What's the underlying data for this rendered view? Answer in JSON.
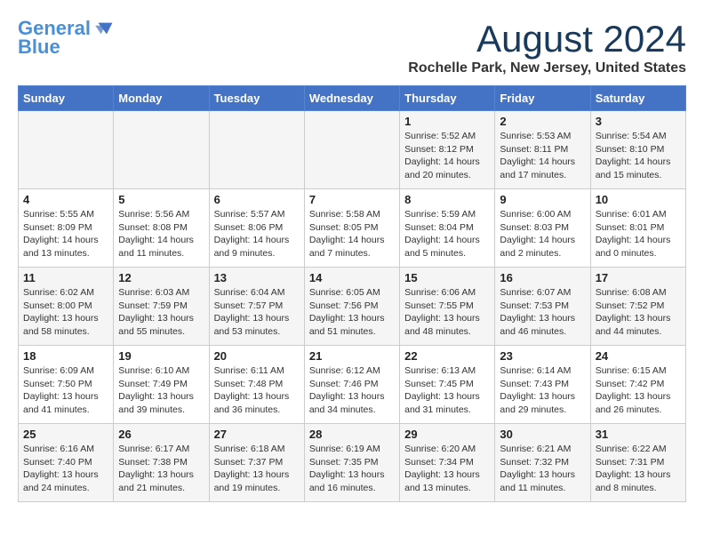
{
  "header": {
    "logo_line1": "General",
    "logo_line2": "Blue",
    "month_year": "August 2024",
    "location": "Rochelle Park, New Jersey, United States"
  },
  "weekdays": [
    "Sunday",
    "Monday",
    "Tuesday",
    "Wednesday",
    "Thursday",
    "Friday",
    "Saturday"
  ],
  "weeks": [
    [
      {
        "day": "",
        "content": ""
      },
      {
        "day": "",
        "content": ""
      },
      {
        "day": "",
        "content": ""
      },
      {
        "day": "",
        "content": ""
      },
      {
        "day": "1",
        "content": "Sunrise: 5:52 AM\nSunset: 8:12 PM\nDaylight: 14 hours\nand 20 minutes."
      },
      {
        "day": "2",
        "content": "Sunrise: 5:53 AM\nSunset: 8:11 PM\nDaylight: 14 hours\nand 17 minutes."
      },
      {
        "day": "3",
        "content": "Sunrise: 5:54 AM\nSunset: 8:10 PM\nDaylight: 14 hours\nand 15 minutes."
      }
    ],
    [
      {
        "day": "4",
        "content": "Sunrise: 5:55 AM\nSunset: 8:09 PM\nDaylight: 14 hours\nand 13 minutes."
      },
      {
        "day": "5",
        "content": "Sunrise: 5:56 AM\nSunset: 8:08 PM\nDaylight: 14 hours\nand 11 minutes."
      },
      {
        "day": "6",
        "content": "Sunrise: 5:57 AM\nSunset: 8:06 PM\nDaylight: 14 hours\nand 9 minutes."
      },
      {
        "day": "7",
        "content": "Sunrise: 5:58 AM\nSunset: 8:05 PM\nDaylight: 14 hours\nand 7 minutes."
      },
      {
        "day": "8",
        "content": "Sunrise: 5:59 AM\nSunset: 8:04 PM\nDaylight: 14 hours\nand 5 minutes."
      },
      {
        "day": "9",
        "content": "Sunrise: 6:00 AM\nSunset: 8:03 PM\nDaylight: 14 hours\nand 2 minutes."
      },
      {
        "day": "10",
        "content": "Sunrise: 6:01 AM\nSunset: 8:01 PM\nDaylight: 14 hours\nand 0 minutes."
      }
    ],
    [
      {
        "day": "11",
        "content": "Sunrise: 6:02 AM\nSunset: 8:00 PM\nDaylight: 13 hours\nand 58 minutes."
      },
      {
        "day": "12",
        "content": "Sunrise: 6:03 AM\nSunset: 7:59 PM\nDaylight: 13 hours\nand 55 minutes."
      },
      {
        "day": "13",
        "content": "Sunrise: 6:04 AM\nSunset: 7:57 PM\nDaylight: 13 hours\nand 53 minutes."
      },
      {
        "day": "14",
        "content": "Sunrise: 6:05 AM\nSunset: 7:56 PM\nDaylight: 13 hours\nand 51 minutes."
      },
      {
        "day": "15",
        "content": "Sunrise: 6:06 AM\nSunset: 7:55 PM\nDaylight: 13 hours\nand 48 minutes."
      },
      {
        "day": "16",
        "content": "Sunrise: 6:07 AM\nSunset: 7:53 PM\nDaylight: 13 hours\nand 46 minutes."
      },
      {
        "day": "17",
        "content": "Sunrise: 6:08 AM\nSunset: 7:52 PM\nDaylight: 13 hours\nand 44 minutes."
      }
    ],
    [
      {
        "day": "18",
        "content": "Sunrise: 6:09 AM\nSunset: 7:50 PM\nDaylight: 13 hours\nand 41 minutes."
      },
      {
        "day": "19",
        "content": "Sunrise: 6:10 AM\nSunset: 7:49 PM\nDaylight: 13 hours\nand 39 minutes."
      },
      {
        "day": "20",
        "content": "Sunrise: 6:11 AM\nSunset: 7:48 PM\nDaylight: 13 hours\nand 36 minutes."
      },
      {
        "day": "21",
        "content": "Sunrise: 6:12 AM\nSunset: 7:46 PM\nDaylight: 13 hours\nand 34 minutes."
      },
      {
        "day": "22",
        "content": "Sunrise: 6:13 AM\nSunset: 7:45 PM\nDaylight: 13 hours\nand 31 minutes."
      },
      {
        "day": "23",
        "content": "Sunrise: 6:14 AM\nSunset: 7:43 PM\nDaylight: 13 hours\nand 29 minutes."
      },
      {
        "day": "24",
        "content": "Sunrise: 6:15 AM\nSunset: 7:42 PM\nDaylight: 13 hours\nand 26 minutes."
      }
    ],
    [
      {
        "day": "25",
        "content": "Sunrise: 6:16 AM\nSunset: 7:40 PM\nDaylight: 13 hours\nand 24 minutes."
      },
      {
        "day": "26",
        "content": "Sunrise: 6:17 AM\nSunset: 7:38 PM\nDaylight: 13 hours\nand 21 minutes."
      },
      {
        "day": "27",
        "content": "Sunrise: 6:18 AM\nSunset: 7:37 PM\nDaylight: 13 hours\nand 19 minutes."
      },
      {
        "day": "28",
        "content": "Sunrise: 6:19 AM\nSunset: 7:35 PM\nDaylight: 13 hours\nand 16 minutes."
      },
      {
        "day": "29",
        "content": "Sunrise: 6:20 AM\nSunset: 7:34 PM\nDaylight: 13 hours\nand 13 minutes."
      },
      {
        "day": "30",
        "content": "Sunrise: 6:21 AM\nSunset: 7:32 PM\nDaylight: 13 hours\nand 11 minutes."
      },
      {
        "day": "31",
        "content": "Sunrise: 6:22 AM\nSunset: 7:31 PM\nDaylight: 13 hours\nand 8 minutes."
      }
    ]
  ]
}
